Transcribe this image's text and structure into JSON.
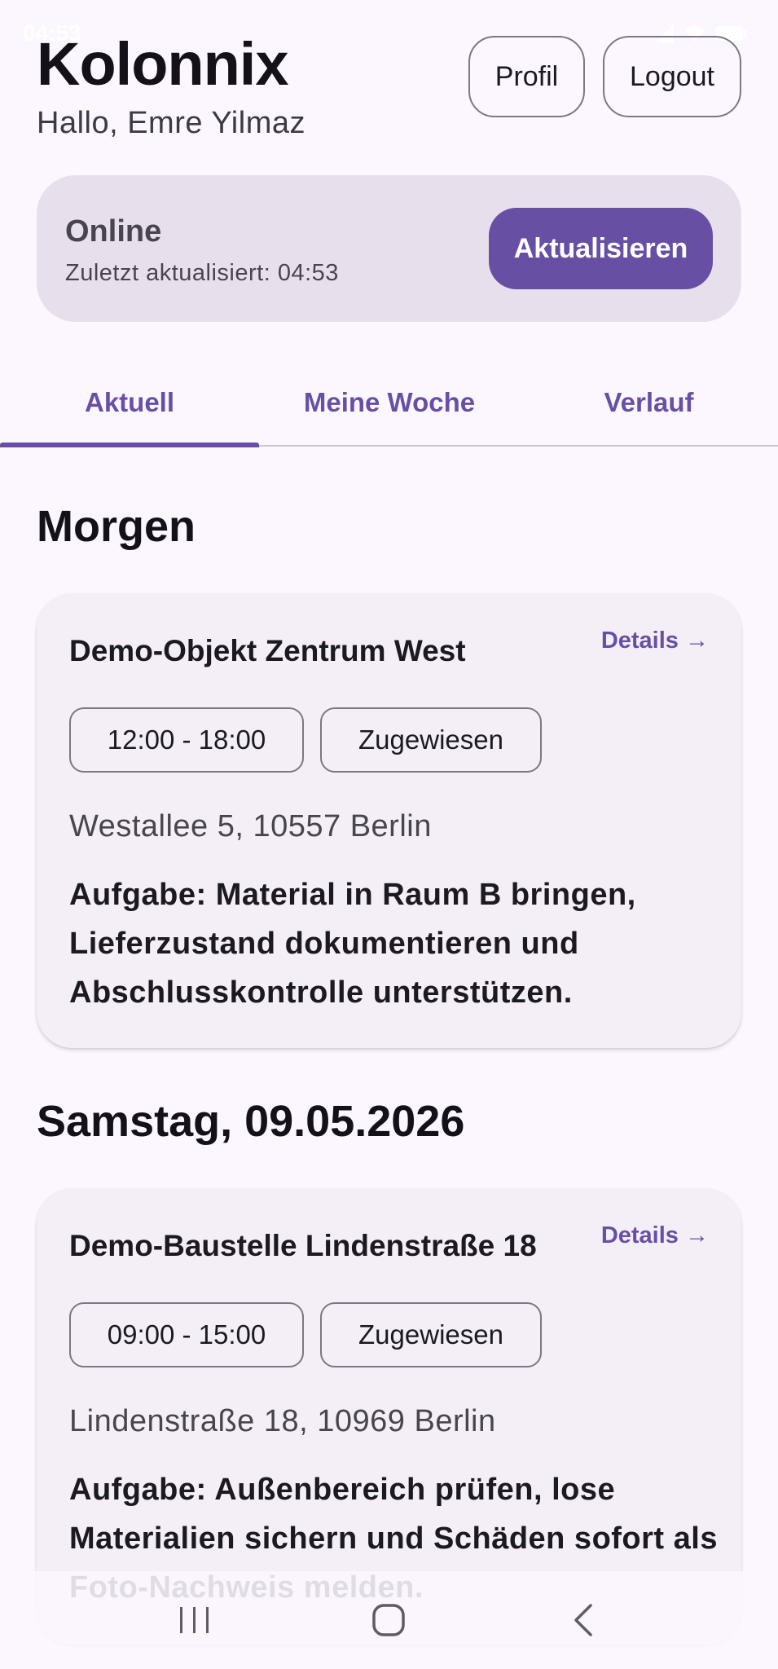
{
  "app": {
    "title": "Kolonnix",
    "greeting": "Hallo, Emre Yilmaz"
  },
  "status_bar": {
    "time": "04:53"
  },
  "header": {
    "profil_label": "Profil",
    "logout_label": "Logout"
  },
  "connection": {
    "status": "Online",
    "last_updated": "Zuletzt aktualisiert: 04:53",
    "refresh_label": "Aktualisieren"
  },
  "tabs": [
    {
      "label": "Aktuell",
      "active": true
    },
    {
      "label": "Meine Woche",
      "active": false
    },
    {
      "label": "Verlauf",
      "active": false
    }
  ],
  "sections": [
    {
      "title": "Morgen",
      "card": {
        "title": "Demo-Objekt Zentrum West",
        "details_label": "Details →",
        "time": "12:00 - 18:00",
        "status": "Zugewiesen",
        "address": "Westallee 5, 10557 Berlin",
        "task": "Aufgabe: Material in Raum B bringen, Lieferzustand dokumentieren und Abschlusskontrolle unterstützen."
      }
    },
    {
      "title": "Samstag, 09.05.2026",
      "card": {
        "title": "Demo-Baustelle Lindenstraße 18",
        "details_label": "Details →",
        "time": "09:00 - 15:00",
        "status": "Zugewiesen",
        "address": "Lindenstraße 18, 10969 Berlin",
        "task": "Aufgabe: Außenbereich prüfen, lose Materialien sichern und Schäden sofort als Foto-Nachweis melden."
      }
    }
  ],
  "colors": {
    "primary": "#6750a4",
    "background": "#fcf7fe",
    "surface_variant": "#e7e0ec",
    "card": "#f4eff6"
  },
  "nav_icons": [
    "recent-apps-icon",
    "home-icon",
    "back-icon"
  ]
}
